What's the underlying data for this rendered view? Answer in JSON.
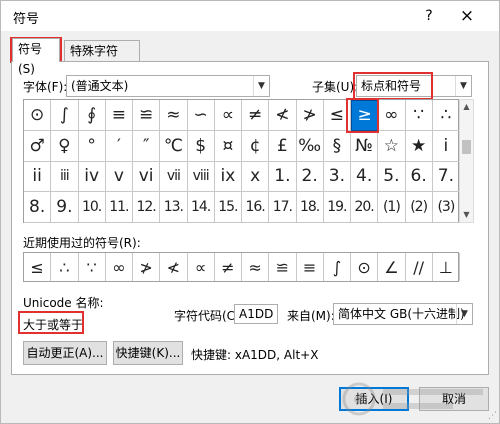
{
  "window": {
    "title": "符号",
    "help_icon": "?",
    "close_icon": "×"
  },
  "tabs": [
    {
      "label": "符号(S)",
      "active": true
    },
    {
      "label": "特殊字符(P)",
      "active": false
    }
  ],
  "font": {
    "label": "字体(F):",
    "value": "(普通文本)"
  },
  "subset": {
    "label": "子集(U):",
    "value": "标点和符号"
  },
  "symbol_grid": [
    [
      "⊙",
      "∫",
      "∮",
      "≡",
      "≌",
      "≈",
      "∽",
      "∝",
      "≠",
      "≮",
      "≯",
      "≤",
      "≥",
      "∞",
      "∵",
      "∴"
    ],
    [
      "♂",
      "♀",
      "°",
      "′",
      "″",
      "℃",
      "$",
      "¤",
      "¢",
      "£",
      "‰",
      "§",
      "№",
      "☆",
      "★",
      "i"
    ],
    [
      "ii",
      "iii",
      "iv",
      "v",
      "vi",
      "vii",
      "viii",
      "ix",
      "x",
      "1.",
      "2.",
      "3.",
      "4.",
      "5.",
      "6.",
      "7."
    ],
    [
      "8.",
      "9.",
      "10.",
      "11.",
      "12.",
      "13.",
      "14.",
      "15.",
      "16.",
      "17.",
      "18.",
      "19.",
      "20.",
      "(1)",
      "(2)",
      "(3)"
    ]
  ],
  "selected_symbol": "≥",
  "recent": {
    "label": "近期使用过的符号(R):",
    "symbols": [
      "≤",
      "∴",
      "∵",
      "∞",
      "≯",
      "≮",
      "∝",
      "≠",
      "≈",
      "≌",
      "≡",
      "∫",
      "⊙",
      "∠",
      "//",
      "⊥"
    ]
  },
  "unicode": {
    "label": "Unicode 名称:",
    "name": "大于或等于"
  },
  "char_code": {
    "label": "字符代码(C):",
    "value": "A1DD"
  },
  "from": {
    "label": "来自(M):",
    "value": "简体中文 GB(十六进制)"
  },
  "buttons": {
    "autocorrect": "自动更正(A)...",
    "shortcut_key": "快捷键(K)...",
    "insert": "插入(I)",
    "cancel": "取消"
  },
  "shortcut_text": "快捷键: xA1DD, Alt+X",
  "colors": {
    "highlight_red": "#e03030",
    "selection_blue": "#0078d7"
  }
}
